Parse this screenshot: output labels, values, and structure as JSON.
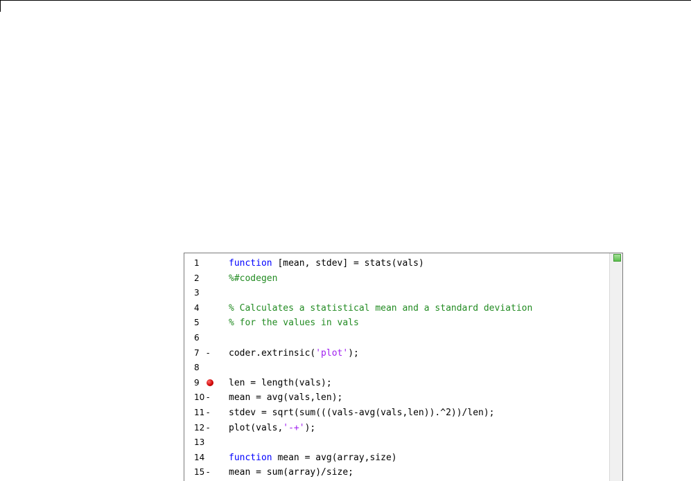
{
  "colors": {
    "keyword": "#0000ff",
    "comment": "#228b22",
    "string": "#a020f0",
    "breakpoint": "#cc0000",
    "status_ok": "#5cbf4d"
  },
  "editor": {
    "status_indicator": "green-square-icon",
    "lines": [
      {
        "num": "1",
        "marker": "",
        "breakpoint": false,
        "parts": [
          {
            "t": "function",
            "c": "kw"
          },
          {
            "t": " [mean, stdev] = stats(vals)",
            "c": ""
          }
        ]
      },
      {
        "num": "2",
        "marker": "",
        "breakpoint": false,
        "parts": [
          {
            "t": "%#codegen",
            "c": "cm"
          }
        ]
      },
      {
        "num": "3",
        "marker": "",
        "breakpoint": false,
        "parts": []
      },
      {
        "num": "4",
        "marker": "",
        "breakpoint": false,
        "parts": [
          {
            "t": "% Calculates a statistical mean and a standard deviation",
            "c": "cm"
          }
        ]
      },
      {
        "num": "5",
        "marker": "",
        "breakpoint": false,
        "parts": [
          {
            "t": "% for the values in vals",
            "c": "cm"
          }
        ]
      },
      {
        "num": "6",
        "marker": "",
        "breakpoint": false,
        "parts": []
      },
      {
        "num": "7",
        "marker": "-",
        "breakpoint": false,
        "parts": [
          {
            "t": "coder.extrinsic(",
            "c": ""
          },
          {
            "t": "'plot'",
            "c": "st"
          },
          {
            "t": ");",
            "c": ""
          }
        ]
      },
      {
        "num": "8",
        "marker": "",
        "breakpoint": false,
        "parts": []
      },
      {
        "num": "9",
        "marker": "",
        "breakpoint": true,
        "parts": [
          {
            "t": "len = length(vals);",
            "c": ""
          }
        ]
      },
      {
        "num": "10",
        "marker": "-",
        "breakpoint": false,
        "parts": [
          {
            "t": "mean = avg(vals,len);",
            "c": ""
          }
        ]
      },
      {
        "num": "11",
        "marker": "-",
        "breakpoint": false,
        "parts": [
          {
            "t": "stdev = sqrt(sum(((vals-avg(vals,len)).^2))/len);",
            "c": ""
          }
        ]
      },
      {
        "num": "12",
        "marker": "-",
        "breakpoint": false,
        "parts": [
          {
            "t": "plot(vals,",
            "c": ""
          },
          {
            "t": "'-+'",
            "c": "st"
          },
          {
            "t": ");",
            "c": ""
          }
        ]
      },
      {
        "num": "13",
        "marker": "",
        "breakpoint": false,
        "parts": []
      },
      {
        "num": "14",
        "marker": "",
        "breakpoint": false,
        "parts": [
          {
            "t": "function",
            "c": "kw"
          },
          {
            "t": " mean = avg(array,size)",
            "c": ""
          }
        ]
      },
      {
        "num": "15",
        "marker": "-",
        "breakpoint": false,
        "parts": [
          {
            "t": "mean = sum(array)/size;",
            "c": ""
          }
        ]
      }
    ]
  }
}
